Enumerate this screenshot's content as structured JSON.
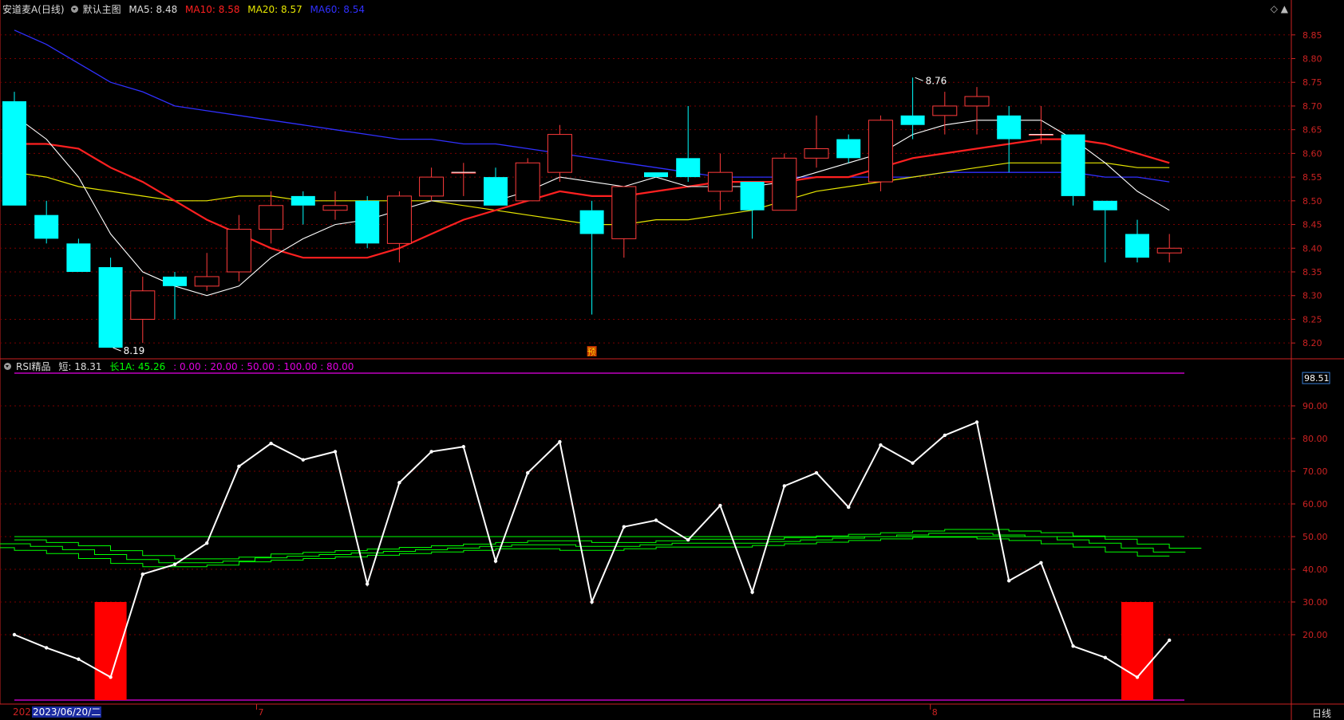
{
  "main_header": {
    "title": "安道麦A(日线)",
    "template": "默认主图",
    "ma5_label": "MA5:",
    "ma5_value": "8.48",
    "ma10_label": "MA10:",
    "ma10_value": "8.58",
    "ma20_label": "MA20:",
    "ma20_value": "8.57",
    "ma60_label": "MA60:",
    "ma60_value": "8.54"
  },
  "rsi_header": {
    "title": "RSI精品",
    "short_label": "短:",
    "short_value": "18.31",
    "long_label": "长1A:",
    "long_value": "45.26",
    "levels": ": 0.00 : 20.00 : 50.00 : 100.00 : 80.00"
  },
  "x_axis": {
    "year_label": "202",
    "cursor_date": "2023/06/20/二",
    "month_labels": [
      {
        "text": "7",
        "index": 8
      },
      {
        "text": "8",
        "index": 29
      }
    ]
  },
  "period_button": "日线",
  "colors": {
    "up": "#ff3b3b",
    "down": "#00ffff",
    "ma5": "#ffffff",
    "ma10": "#ff2020",
    "ma20": "#e6e600",
    "ma60": "#3030ff",
    "rsi_short": "#ffffff",
    "rsi_long": "#00ff00",
    "grid": "#7a0000",
    "axis": "#cc2222",
    "level_line": "#c000c0"
  },
  "chart_data": [
    {
      "type": "candlestick",
      "title": "安道麦A(日线)",
      "ylim": [
        8.17,
        8.89
      ],
      "y_ticks": [
        8.2,
        8.25,
        8.3,
        8.35,
        8.4,
        8.45,
        8.5,
        8.55,
        8.6,
        8.65,
        8.7,
        8.75,
        8.8,
        8.85
      ],
      "ohlc": [
        [
          8.71,
          8.73,
          8.49,
          8.49
        ],
        [
          8.47,
          8.5,
          8.41,
          8.42
        ],
        [
          8.41,
          8.42,
          8.35,
          8.35
        ],
        [
          8.36,
          8.38,
          8.19,
          8.19
        ],
        [
          8.25,
          8.34,
          8.2,
          8.31
        ],
        [
          8.34,
          8.35,
          8.25,
          8.32
        ],
        [
          8.32,
          8.39,
          8.31,
          8.34
        ],
        [
          8.35,
          8.47,
          8.33,
          8.44
        ],
        [
          8.44,
          8.52,
          8.41,
          8.49
        ],
        [
          8.51,
          8.52,
          8.45,
          8.49
        ],
        [
          8.48,
          8.52,
          8.46,
          8.49
        ],
        [
          8.5,
          8.51,
          8.4,
          8.41
        ],
        [
          8.41,
          8.52,
          8.37,
          8.51
        ],
        [
          8.51,
          8.57,
          8.5,
          8.55
        ],
        [
          8.56,
          8.58,
          8.51,
          8.56
        ],
        [
          8.55,
          8.57,
          8.49,
          8.49
        ],
        [
          8.5,
          8.59,
          8.5,
          8.58
        ],
        [
          8.56,
          8.66,
          8.54,
          8.64
        ],
        [
          8.48,
          8.5,
          8.26,
          8.43
        ],
        [
          8.42,
          8.53,
          8.38,
          8.53
        ],
        [
          8.56,
          8.56,
          8.55,
          8.55
        ],
        [
          8.59,
          8.7,
          8.54,
          8.55
        ],
        [
          8.52,
          8.6,
          8.48,
          8.56
        ],
        [
          8.54,
          8.54,
          8.42,
          8.48
        ],
        [
          8.48,
          8.6,
          8.48,
          8.59
        ],
        [
          8.59,
          8.68,
          8.57,
          8.61
        ],
        [
          8.63,
          8.64,
          8.58,
          8.59
        ],
        [
          8.54,
          8.68,
          8.52,
          8.67
        ],
        [
          8.68,
          8.76,
          8.63,
          8.66
        ],
        [
          8.68,
          8.73,
          8.64,
          8.7
        ],
        [
          8.7,
          8.74,
          8.64,
          8.72
        ],
        [
          8.68,
          8.7,
          8.56,
          8.63
        ],
        [
          8.64,
          8.7,
          8.62,
          8.64
        ],
        [
          8.64,
          8.64,
          8.49,
          8.51
        ],
        [
          8.5,
          8.5,
          8.37,
          8.48
        ],
        [
          8.43,
          8.46,
          8.37,
          8.38
        ],
        [
          8.39,
          8.43,
          8.37,
          8.4
        ]
      ],
      "ma5": [
        8.68,
        8.63,
        8.55,
        8.43,
        8.35,
        8.32,
        8.3,
        8.32,
        8.38,
        8.42,
        8.45,
        8.46,
        8.48,
        8.5,
        8.5,
        8.5,
        8.52,
        8.55,
        8.54,
        8.53,
        8.55,
        8.53,
        8.53,
        8.53,
        8.54,
        8.56,
        8.58,
        8.6,
        8.64,
        8.66,
        8.67,
        8.67,
        8.67,
        8.63,
        8.58,
        8.52,
        8.48
      ],
      "ma10": [
        8.62,
        8.62,
        8.61,
        8.57,
        8.54,
        8.5,
        8.46,
        8.43,
        8.4,
        8.38,
        8.38,
        8.38,
        8.4,
        8.43,
        8.46,
        8.48,
        8.5,
        8.52,
        8.51,
        8.51,
        8.52,
        8.53,
        8.54,
        8.54,
        8.54,
        8.55,
        8.55,
        8.57,
        8.59,
        8.6,
        8.61,
        8.62,
        8.63,
        8.63,
        8.62,
        8.6,
        8.58
      ],
      "ma20": [
        8.56,
        8.55,
        8.53,
        8.52,
        8.51,
        8.5,
        8.5,
        8.51,
        8.51,
        8.5,
        8.5,
        8.5,
        8.5,
        8.5,
        8.49,
        8.48,
        8.47,
        8.46,
        8.45,
        8.45,
        8.46,
        8.46,
        8.47,
        8.48,
        8.5,
        8.52,
        8.53,
        8.54,
        8.55,
        8.56,
        8.57,
        8.58,
        8.58,
        8.58,
        8.58,
        8.57,
        8.57
      ],
      "ma60": [
        8.86,
        8.83,
        8.79,
        8.75,
        8.73,
        8.7,
        8.69,
        8.68,
        8.67,
        8.66,
        8.65,
        8.64,
        8.63,
        8.63,
        8.62,
        8.62,
        8.61,
        8.6,
        8.59,
        8.58,
        8.57,
        8.56,
        8.55,
        8.55,
        8.55,
        8.55,
        8.55,
        8.55,
        8.55,
        8.56,
        8.56,
        8.56,
        8.56,
        8.56,
        8.55,
        8.55,
        8.54
      ],
      "annotations": [
        {
          "text": "8.76",
          "index": 28,
          "value": 8.76
        },
        {
          "text": "8.19",
          "index": 3,
          "value": 8.19
        }
      ],
      "marker_label": "预",
      "marker_index": 18
    },
    {
      "type": "line",
      "title": "RSI精品",
      "ylim": [
        0,
        100
      ],
      "y_ticks": [
        20,
        30,
        40,
        50,
        60,
        70,
        80,
        90
      ],
      "top_value_label": "98.51",
      "series": [
        {
          "name": "短",
          "values": [
            20.0,
            16.0,
            12.5,
            7.0,
            38.5,
            41.5,
            48.0,
            71.5,
            78.5,
            73.5,
            76.0,
            35.5,
            66.5,
            76.0,
            77.5,
            42.5,
            69.5,
            79.0,
            30.0,
            53.0,
            55.0,
            49.0,
            59.5,
            33.0,
            65.5,
            69.5,
            59.0,
            78.0,
            72.5,
            81.0,
            85.0,
            36.5,
            42.0,
            16.5,
            13.0,
            7.0,
            18.31
          ]
        },
        {
          "name": "长1A",
          "values": [
            47.8,
            47.0,
            46.0,
            44.5,
            43.0,
            42.0,
            42.0,
            42.5,
            43.5,
            44.0,
            44.5,
            45.0,
            45.5,
            46.0,
            46.5,
            47.0,
            47.5,
            47.5,
            47.0,
            47.0,
            47.5,
            48.0,
            48.0,
            48.0,
            48.5,
            49.0,
            49.5,
            50.0,
            50.5,
            51.0,
            51.0,
            50.5,
            50.0,
            49.0,
            48.0,
            46.5,
            45.26
          ]
        }
      ],
      "reference_lines": [
        0,
        20,
        50,
        100,
        80
      ],
      "signal_bars": [
        {
          "index": 3,
          "from": 0,
          "to": 30
        },
        {
          "index": 35,
          "from": 0,
          "to": 30
        }
      ]
    }
  ]
}
